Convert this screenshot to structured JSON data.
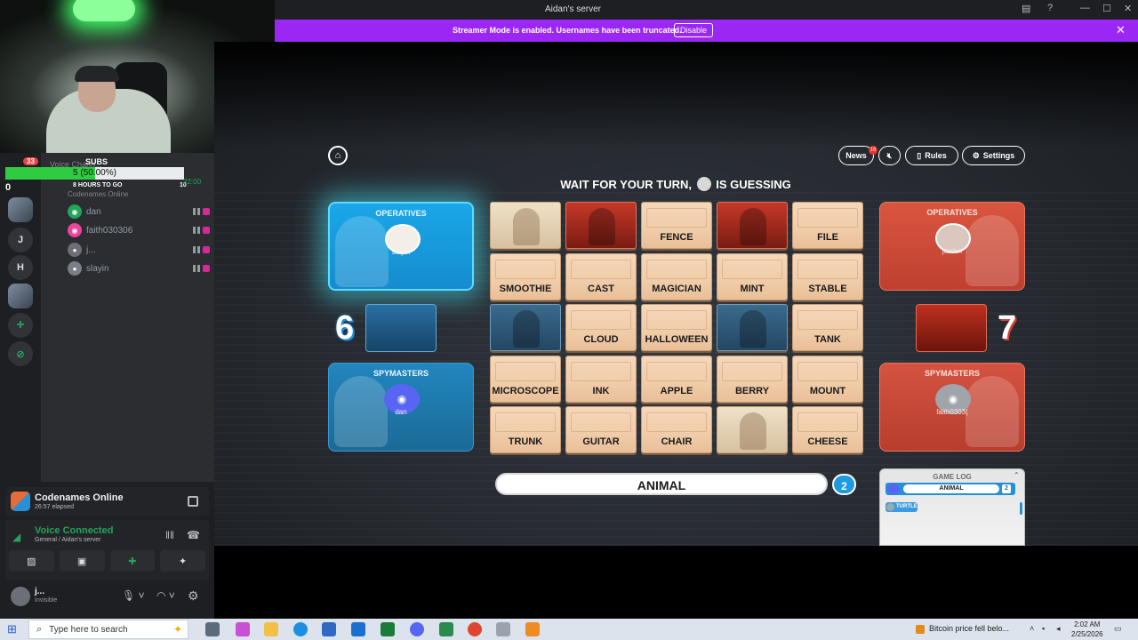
{
  "window": {
    "title": "Aidan's server",
    "controls": [
      "—",
      "☐",
      "✕"
    ]
  },
  "banner": {
    "message": "Streamer Mode is enabled. Usernames have been truncated.",
    "disable_label": "Disable"
  },
  "overlay": {
    "subs_label": "SUBS",
    "subs_value": "5 (50.00%)",
    "subs_progress": 0.5,
    "goal_text": "8 HOURS TO GO",
    "goal_max": "10",
    "badge_count": "33",
    "voice_channel_ghost": "Voice Chann...",
    "activity_sub": "Codenames Online",
    "timer": "22:00"
  },
  "server_rail": {
    "left_num": "0",
    "letters": [
      "J",
      "H"
    ],
    "plus": "+",
    "explore": "⊘"
  },
  "voice_users": [
    {
      "name": "dan",
      "avatar_color": "#23a55a",
      "glyph": "◉"
    },
    {
      "name": "faith030306",
      "avatar_color": "#eb459e",
      "glyph": "◉"
    },
    {
      "name": "j...",
      "avatar_color": "#6d6f78",
      "glyph": "●"
    },
    {
      "name": "slayin",
      "avatar_color": "#7a7f87",
      "glyph": "●"
    }
  ],
  "activity": {
    "name": "Codenames Online",
    "elapsed": "26:57 elapsed"
  },
  "voice_panel": {
    "status": "Voice Connected",
    "location": "General / Aidan's server"
  },
  "user_panel": {
    "name": "j...",
    "status": "Invisible"
  },
  "game": {
    "turn_prefix": "WAIT FOR YOUR TURN,",
    "turn_suffix": "IS GUESSING",
    "nav": {
      "news": "News",
      "news_badge": "16",
      "rules": "Rules",
      "settings": "Settings"
    },
    "blue_team": {
      "operatives_label": "OPERATIVES",
      "operative": "slayin",
      "spymasters_label": "SPYMASTERS",
      "spymaster": "dan",
      "score": "6"
    },
    "red_team": {
      "operatives_label": "OPERATIVES",
      "operative": "jarrien",
      "spymasters_label": "SPYMASTERS",
      "spymaster": "faith0303(",
      "score": "7"
    },
    "cards": [
      {
        "word": "",
        "type": "neutral"
      },
      {
        "word": "",
        "type": "red"
      },
      {
        "word": "FENCE",
        "type": "word"
      },
      {
        "word": "",
        "type": "red"
      },
      {
        "word": "FILE",
        "type": "word"
      },
      {
        "word": "SMOOTHIE",
        "type": "word"
      },
      {
        "word": "CAST",
        "type": "word"
      },
      {
        "word": "MAGICIAN",
        "type": "word"
      },
      {
        "word": "MINT",
        "type": "word"
      },
      {
        "word": "STABLE",
        "type": "word"
      },
      {
        "word": "",
        "type": "blue"
      },
      {
        "word": "CLOUD",
        "type": "word"
      },
      {
        "word": "HALLOWEEN",
        "type": "word"
      },
      {
        "word": "",
        "type": "blue"
      },
      {
        "word": "TANK",
        "type": "word"
      },
      {
        "word": "MICROSCOPE",
        "type": "word"
      },
      {
        "word": "INK",
        "type": "word"
      },
      {
        "word": "APPLE",
        "type": "word"
      },
      {
        "word": "BERRY",
        "type": "word"
      },
      {
        "word": "MOUNT",
        "type": "word"
      },
      {
        "word": "TRUNK",
        "type": "word"
      },
      {
        "word": "GUITAR",
        "type": "word"
      },
      {
        "word": "CHAIR",
        "type": "word"
      },
      {
        "word": "",
        "type": "neutral"
      },
      {
        "word": "CHEESE",
        "type": "word"
      }
    ],
    "clue": {
      "word": "ANIMAL",
      "number": "2"
    },
    "log": {
      "title": "GAME LOG",
      "entry_word": "ANIMAL",
      "entry_number": "2",
      "guess_user": "TURTLE"
    }
  },
  "taskbar": {
    "search_placeholder": "Type here to search",
    "news": "Bitcoin price fell belo...",
    "time": "2:02 AM",
    "date": "2/25/2026"
  }
}
